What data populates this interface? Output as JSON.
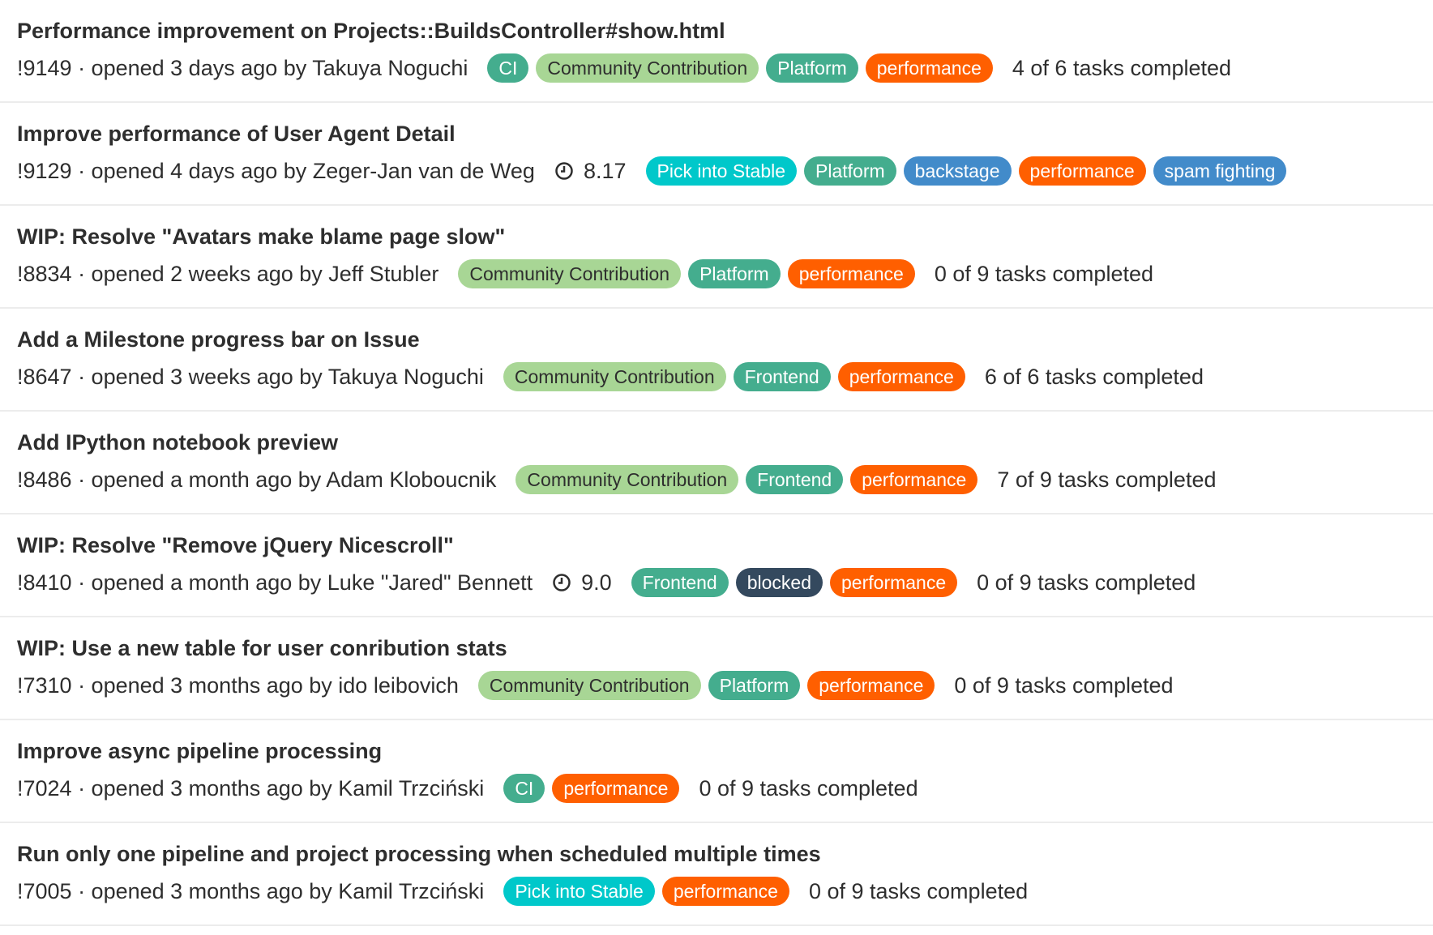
{
  "colors": {
    "CI": "#44ad8e",
    "Community Contribution": "#a8d695",
    "Platform": "#44ad8e",
    "Frontend": "#44ad8e",
    "performance": "#ff5f00",
    "Pick into Stable": "#00c8ca",
    "backstage": "#428bca",
    "spam fighting": "#428bca",
    "blocked": "#34495e"
  },
  "merge_requests": [
    {
      "title": "Performance improvement on Projects::BuildsController#show.html",
      "meta": "!9149 · opened 3 days ago by Takuya Noguchi",
      "milestone": null,
      "labels": [
        "CI",
        "Community Contribution",
        "Platform",
        "performance"
      ],
      "tasks": "4 of 6 tasks completed"
    },
    {
      "title": "Improve performance of User Agent Detail",
      "meta": "!9129 · opened 4 days ago by Zeger-Jan van de Weg",
      "milestone": "8.17",
      "labels": [
        "Pick into Stable",
        "Platform",
        "backstage",
        "performance",
        "spam fighting"
      ],
      "tasks": null
    },
    {
      "title": "WIP: Resolve \"Avatars make blame page slow\"",
      "meta": "!8834 · opened 2 weeks ago by Jeff Stubler",
      "milestone": null,
      "labels": [
        "Community Contribution",
        "Platform",
        "performance"
      ],
      "tasks": "0 of 9 tasks completed"
    },
    {
      "title": "Add a Milestone progress bar on Issue",
      "meta": "!8647 · opened 3 weeks ago by Takuya Noguchi",
      "milestone": null,
      "labels": [
        "Community Contribution",
        "Frontend",
        "performance"
      ],
      "tasks": "6 of 6 tasks completed"
    },
    {
      "title": "Add IPython notebook preview",
      "meta": "!8486 · opened a month ago by Adam Kloboucnik",
      "milestone": null,
      "labels": [
        "Community Contribution",
        "Frontend",
        "performance"
      ],
      "tasks": "7 of 9 tasks completed"
    },
    {
      "title": "WIP: Resolve \"Remove jQuery Nicescroll\"",
      "meta": "!8410 · opened a month ago by Luke \"Jared\" Bennett",
      "milestone": "9.0",
      "labels": [
        "Frontend",
        "blocked",
        "performance"
      ],
      "tasks": "0 of 9 tasks completed"
    },
    {
      "title": "WIP: Use a new table for user conribution stats",
      "meta": "!7310 · opened 3 months ago by ido leibovich",
      "milestone": null,
      "labels": [
        "Community Contribution",
        "Platform",
        "performance"
      ],
      "tasks": "0 of 9 tasks completed"
    },
    {
      "title": "Improve async pipeline processing",
      "meta": "!7024 · opened 3 months ago by Kamil Trzciński",
      "milestone": null,
      "labels": [
        "CI",
        "performance"
      ],
      "tasks": "0 of 9 tasks completed"
    },
    {
      "title": "Run only one pipeline and project processing when scheduled multiple times",
      "meta": "!7005 · opened 3 months ago by Kamil Trzciński",
      "milestone": null,
      "labels": [
        "Pick into Stable",
        "performance"
      ],
      "tasks": "0 of 9 tasks completed"
    }
  ]
}
